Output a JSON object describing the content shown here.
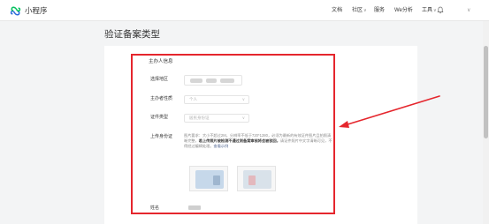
{
  "app": {
    "name": "小程序",
    "logo_icon": "miniprogram-logo-icon",
    "brand_color": "#07c160",
    "logo_color": "#2d6bdc"
  },
  "nav": {
    "items": [
      {
        "label": "文档",
        "has_caret": false
      },
      {
        "label": "社区",
        "has_caret": true
      },
      {
        "label": "服务",
        "has_caret": false
      },
      {
        "label": "We分析",
        "has_caret": false
      },
      {
        "label": "工具",
        "has_caret": true
      }
    ],
    "caret": "∨",
    "notification_icon": "bell-icon"
  },
  "page": {
    "title": "验证备案类型"
  },
  "form": {
    "section_title": "主办人信息",
    "region_label": "选择地区",
    "host_nature_label": "主办者性质",
    "host_nature_value": "个人",
    "cert_type_label": "证件类型",
    "cert_type_value": "居民身份证",
    "upload_label": "上传身份证",
    "upload_desc_plain": "图片要求：大小不超过2M，分辨率不低于720*1280，必须为最新的有效证件图片且拍照清晰完整，",
    "upload_desc_bold": "若上传照片被检测不通过则备案审核将会被驳回，",
    "upload_desc_tail": "请证件照片中文字清晰可见，不得经过编辑处理。",
    "upload_desc_link": "查看示例",
    "name_label": "姓名"
  },
  "annotation": {
    "frame_color": "#e5262d",
    "arrow_color": "#e5262d"
  }
}
